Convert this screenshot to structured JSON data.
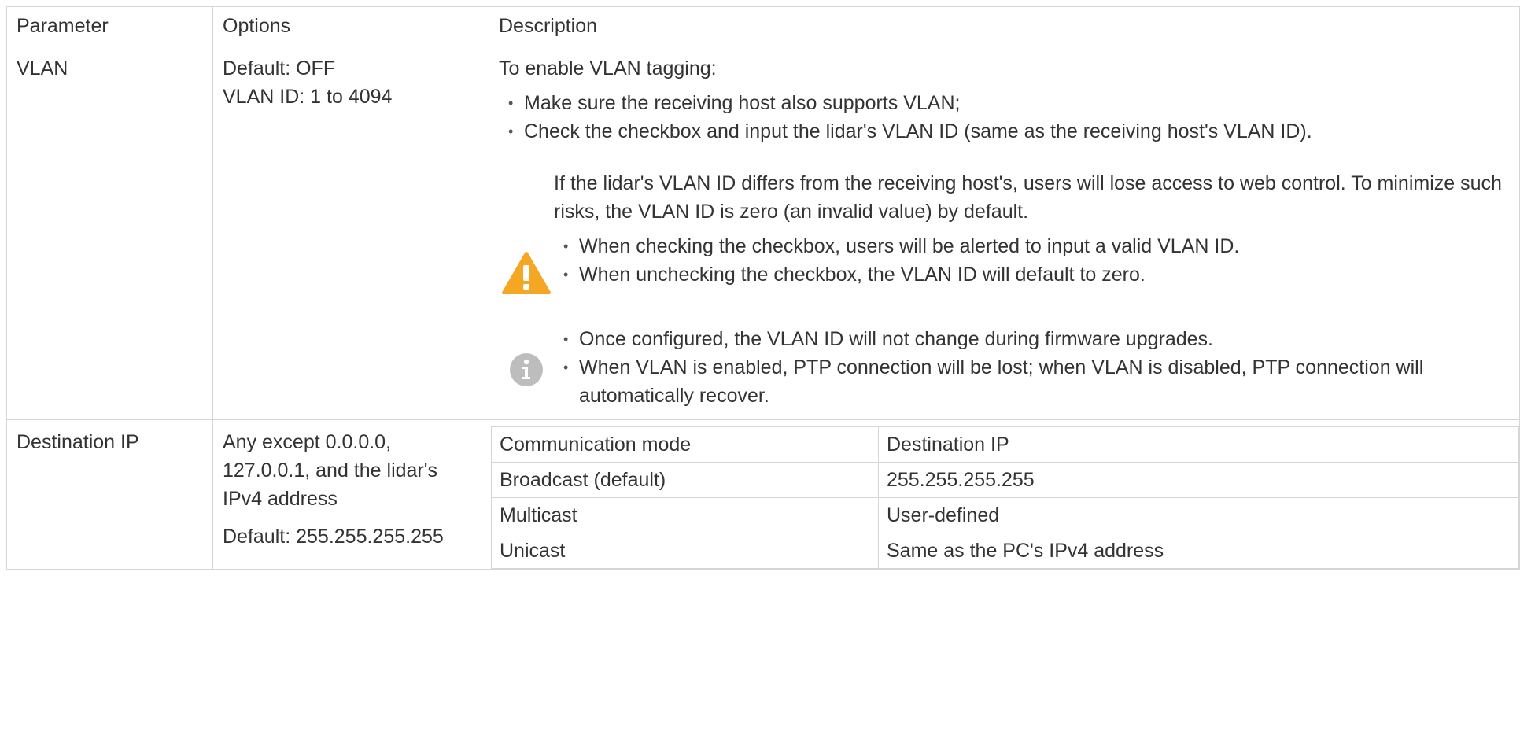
{
  "header": {
    "parameter": "Parameter",
    "options": "Options",
    "description": "Description"
  },
  "rows": {
    "vlan": {
      "parameter": "VLAN",
      "options": [
        "Default: OFF",
        "VLAN ID: 1 to 4094"
      ],
      "intro": "To enable VLAN tagging:",
      "bullets": [
        "Make sure the receiving host also supports VLAN;",
        "Check the checkbox and input the lidar's VLAN ID (same as the receiving host's VLAN ID)."
      ],
      "warning": {
        "icon": "warning-icon",
        "color": "#f5a623",
        "text": "If the lidar's VLAN ID differs from the receiving host's, users will lose access to web control. To minimize such risks, the VLAN ID is zero (an invalid value) by default.",
        "bullets": [
          "When checking the checkbox, users will be alerted to input a valid VLAN ID.",
          "When unchecking the checkbox, the VLAN ID will default to zero."
        ]
      },
      "info": {
        "icon": "info-icon",
        "color": "#bdbdbd",
        "bullets": [
          "Once configured, the VLAN ID will not change during firmware upgrades.",
          "When VLAN is enabled, PTP connection will be lost; when VLAN is disabled, PTP connection will automatically recover."
        ]
      }
    },
    "destination_ip": {
      "parameter": "Destination IP",
      "options": [
        "Any except 0.0.0.0, 127.0.0.1, and the lidar's IPv4 address",
        "Default: 255.255.255.255"
      ],
      "table": {
        "headers": [
          "Communication mode",
          "Destination IP"
        ],
        "rows": [
          [
            "Broadcast (default)",
            "255.255.255.255"
          ],
          [
            "Multicast",
            "User-defined"
          ],
          [
            "Unicast",
            "Same as the PC's IPv4 address"
          ]
        ]
      }
    }
  }
}
